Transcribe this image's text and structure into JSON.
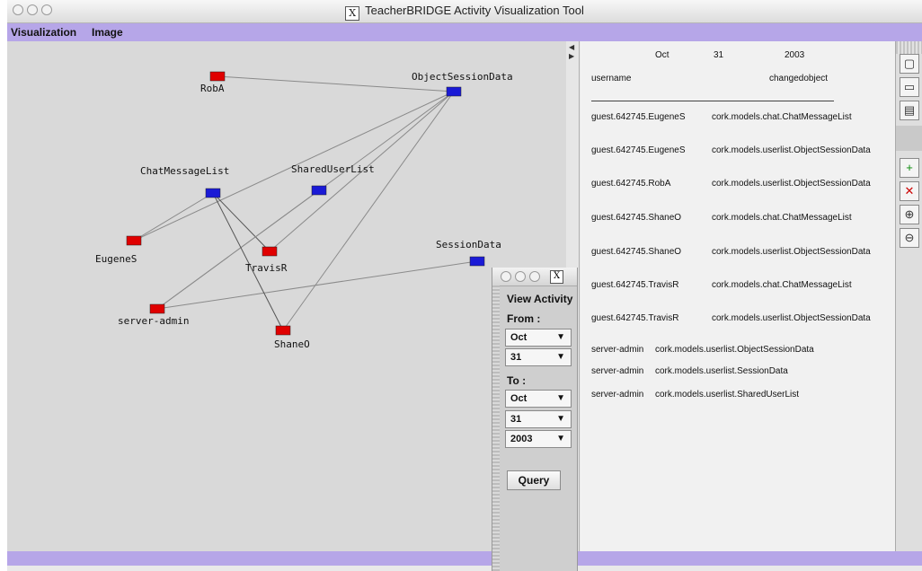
{
  "window": {
    "title": "TeacherBRIDGE Activity Visualization Tool"
  },
  "menu": {
    "items": [
      "Visualization",
      "Image"
    ]
  },
  "graph": {
    "nodes": [
      {
        "id": "RobA",
        "label": "RobA",
        "color": "#e00000"
      },
      {
        "id": "ObjectSessionData",
        "label": "ObjectSessionData",
        "color": "#1a1ad6"
      },
      {
        "id": "ChatMessageList",
        "label": "ChatMessageList",
        "color": "#1a1ad6"
      },
      {
        "id": "SharedUserList",
        "label": "SharedUserList",
        "color": "#1a1ad6"
      },
      {
        "id": "EugeneS",
        "label": "EugeneS",
        "color": "#e00000"
      },
      {
        "id": "TravisR",
        "label": "TravisR",
        "color": "#e00000"
      },
      {
        "id": "SessionData",
        "label": "SessionData",
        "color": "#1a1ad6"
      },
      {
        "id": "server-admin",
        "label": "server-admin",
        "color": "#e00000"
      },
      {
        "id": "ShaneO",
        "label": "ShaneO",
        "color": "#e00000"
      }
    ],
    "edges": [
      [
        "RobA",
        "ObjectSessionData"
      ],
      [
        "EugeneS",
        "ObjectSessionData"
      ],
      [
        "EugeneS",
        "ChatMessageList"
      ],
      [
        "TravisR",
        "ChatMessageList"
      ],
      [
        "TravisR",
        "ObjectSessionData"
      ],
      [
        "server-admin",
        "ObjectSessionData"
      ],
      [
        "server-admin",
        "SharedUserList"
      ],
      [
        "server-admin",
        "SessionData"
      ],
      [
        "ShaneO",
        "ChatMessageList"
      ],
      [
        "ShaneO",
        "ObjectSessionData"
      ]
    ]
  },
  "results": {
    "header": {
      "month": "Oct",
      "day": "31",
      "year": "2003",
      "col_user": "username",
      "col_object": "changedobject"
    },
    "rows": [
      {
        "user": "guest.642745.EugeneS",
        "object": "cork.models.chat.ChatMessageList"
      },
      {
        "user": "guest.642745.EugeneS",
        "object": "cork.models.userlist.ObjectSessionData"
      },
      {
        "user": "guest.642745.RobA",
        "object": "cork.models.userlist.ObjectSessionData"
      },
      {
        "user": "guest.642745.ShaneO",
        "object": "cork.models.chat.ChatMessageList"
      },
      {
        "user": "guest.642745.ShaneO",
        "object": "cork.models.userlist.ObjectSessionData"
      },
      {
        "user": "guest.642745.TravisR",
        "object": "cork.models.chat.ChatMessageList"
      },
      {
        "user": "guest.642745.TravisR",
        "object": "cork.models.userlist.ObjectSessionData"
      },
      {
        "user": "server-admin",
        "object": "cork.models.userlist.ObjectSessionData"
      },
      {
        "user": "server-admin",
        "object": "cork.models.userlist.SessionData"
      },
      {
        "user": "server-admin",
        "object": "cork.models.userlist.SharedUserList"
      }
    ]
  },
  "toolbar": {
    "icons": [
      "new-document-icon",
      "open-icon",
      "save-icon",
      "add-node-icon",
      "delete-node-icon",
      "zoom-in-icon",
      "zoom-out-icon"
    ]
  },
  "dialog": {
    "title": "View Activity",
    "from_label": "From :",
    "from_month": "Oct",
    "from_day": "31",
    "to_label": "To :",
    "to_month": "Oct",
    "to_day": "31",
    "to_year": "2003",
    "query_label": "Query"
  },
  "colors": {
    "menubar": "#b6a6e8",
    "user_node": "#e00000",
    "object_node": "#1a1ad6"
  }
}
